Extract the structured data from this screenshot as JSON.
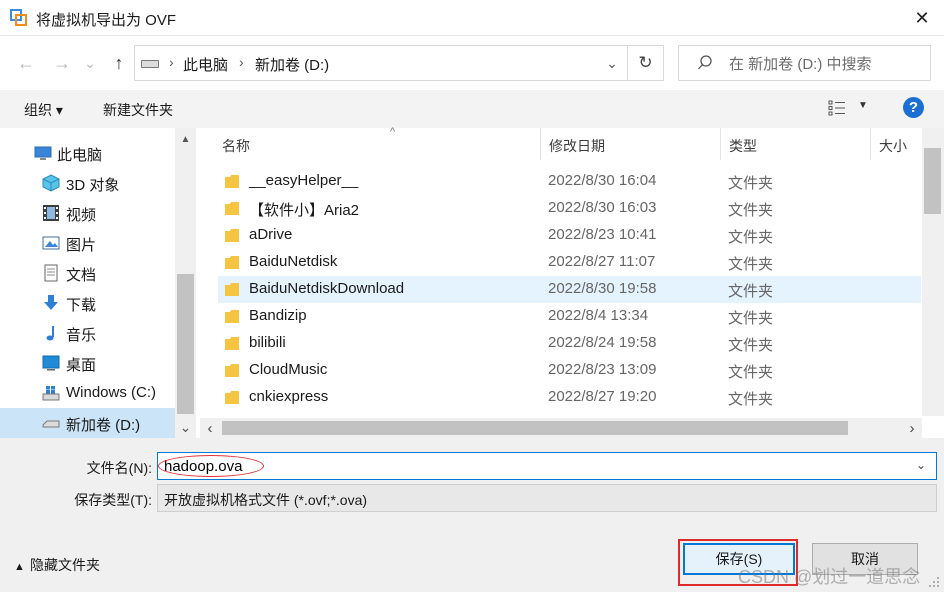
{
  "window": {
    "title": "将虚拟机导出为 OVF",
    "close_icon": "close-icon",
    "close_glyph": "✕"
  },
  "nav": {
    "back_glyph": "←",
    "forward_glyph": "→",
    "recent_glyph": "⌄",
    "up_glyph": "↑",
    "breadcrumb": [
      "此电脑",
      "新加卷 (D:)"
    ],
    "crumb_sep": "›",
    "dropdown_glyph": "⌄",
    "refresh_glyph": "↻",
    "search_placeholder": "在 新加卷 (D:) 中搜索"
  },
  "toolbar": {
    "organize": "组织 ▾",
    "new_folder": "新建文件夹",
    "view_dropdown_glyph": "▼",
    "help_glyph": "?"
  },
  "sidebar": {
    "items": [
      {
        "label": "此电脑",
        "icon": "computer-icon",
        "selected": false
      },
      {
        "label": "3D 对象",
        "icon": "cube-icon",
        "selected": false
      },
      {
        "label": "视频",
        "icon": "film-icon",
        "selected": false
      },
      {
        "label": "图片",
        "icon": "picture-icon",
        "selected": false
      },
      {
        "label": "文档",
        "icon": "document-icon",
        "selected": false
      },
      {
        "label": "下载",
        "icon": "download-arrow-icon",
        "selected": false
      },
      {
        "label": "音乐",
        "icon": "music-note-icon",
        "selected": false
      },
      {
        "label": "桌面",
        "icon": "desktop-icon",
        "selected": false
      },
      {
        "label": "Windows (C:)",
        "icon": "windows-drive-icon",
        "selected": false
      },
      {
        "label": "新加卷 (D:)",
        "icon": "drive-icon",
        "selected": true
      }
    ],
    "scroll_up_glyph": "▲",
    "scroll_down_glyph": "⌄"
  },
  "filelist": {
    "columns": [
      "名称",
      "修改日期",
      "类型",
      "大小"
    ],
    "sort_caret": "^",
    "rows": [
      {
        "name": "__easyHelper__",
        "date": "2022/8/30 16:04",
        "type": "文件夹",
        "selected": false
      },
      {
        "name": "【软件小】Aria2",
        "date": "2022/8/30 16:03",
        "type": "文件夹",
        "selected": false
      },
      {
        "name": "aDrive",
        "date": "2022/8/23 10:41",
        "type": "文件夹",
        "selected": false
      },
      {
        "name": "BaiduNetdisk",
        "date": "2022/8/27 11:07",
        "type": "文件夹",
        "selected": false
      },
      {
        "name": "BaiduNetdiskDownload",
        "date": "2022/8/30 19:58",
        "type": "文件夹",
        "selected": true
      },
      {
        "name": "Bandizip",
        "date": "2022/8/4 13:34",
        "type": "文件夹",
        "selected": false
      },
      {
        "name": "bilibili",
        "date": "2022/8/24 19:58",
        "type": "文件夹",
        "selected": false
      },
      {
        "name": "CloudMusic",
        "date": "2022/8/23 13:09",
        "type": "文件夹",
        "selected": false
      },
      {
        "name": "cnkiexpress",
        "date": "2022/8/27 19:20",
        "type": "文件夹",
        "selected": false
      }
    ],
    "hscroll_left_glyph": "‹",
    "hscroll_right_glyph": "›"
  },
  "form": {
    "filename_label": "文件名(N):",
    "filename_value": "hadoop.ova",
    "filename_dropdown_glyph": "⌄",
    "filetype_label": "保存类型(T):",
    "filetype_value": "开放虚拟机格式文件 (*.ovf;*.ova)",
    "filetype_dropdown_glyph": "⌄"
  },
  "footer": {
    "hide_folders_caret": "▲",
    "hide_folders": "隐藏文件夹",
    "save_button": "保存(S)",
    "cancel_button": "取消",
    "watermark": "CSDN @划过一道思念"
  },
  "colors": {
    "accent": "#0078d7",
    "selection": "#cce4f7",
    "row_highlight": "#e5f3ff",
    "annotation_red": "#e02a2a",
    "folder": "#f5c542"
  }
}
